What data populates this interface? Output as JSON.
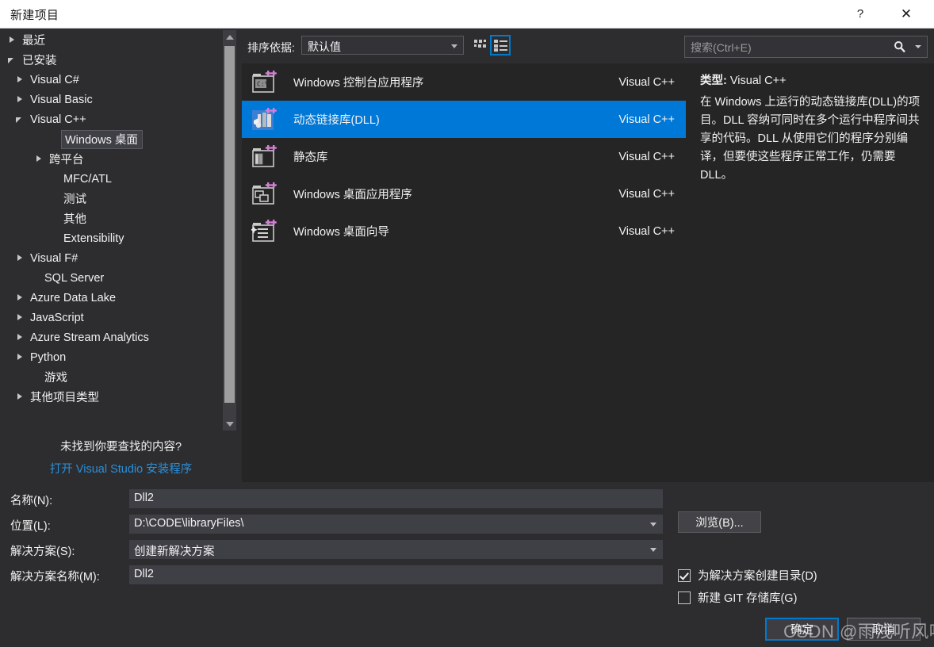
{
  "window": {
    "title": "新建项目",
    "help_label": "?",
    "close_label": "✕"
  },
  "tree": {
    "items": [
      {
        "label": "最近",
        "arrow": "collapsed",
        "indent": 10,
        "selected": false,
        "link": false
      },
      {
        "label": "已安装",
        "arrow": "expanded",
        "indent": 10,
        "selected": false,
        "link": false
      },
      {
        "label": "Visual C#",
        "arrow": "collapsed",
        "indent": 20,
        "selected": false,
        "link": false
      },
      {
        "label": "Visual Basic",
        "arrow": "collapsed",
        "indent": 20,
        "selected": false,
        "link": false
      },
      {
        "label": "Visual C++",
        "arrow": "expanded",
        "indent": 20,
        "selected": false,
        "link": false
      },
      {
        "label": "Windows 桌面",
        "arrow": "none",
        "indent": 62,
        "selected": true,
        "link": false
      },
      {
        "label": "跨平台",
        "arrow": "collapsed",
        "indent": 44,
        "selected": false,
        "link": false
      },
      {
        "label": "MFC/ATL",
        "arrow": "none",
        "indent": 62,
        "selected": false,
        "link": false
      },
      {
        "label": "测试",
        "arrow": "none",
        "indent": 62,
        "selected": false,
        "link": false
      },
      {
        "label": "其他",
        "arrow": "none",
        "indent": 62,
        "selected": false,
        "link": false
      },
      {
        "label": "Extensibility",
        "arrow": "none",
        "indent": 62,
        "selected": false,
        "link": false
      },
      {
        "label": "Visual F#",
        "arrow": "collapsed",
        "indent": 20,
        "selected": false,
        "link": false
      },
      {
        "label": "SQL Server",
        "arrow": "none",
        "indent": 38,
        "selected": false,
        "link": false
      },
      {
        "label": "Azure Data Lake",
        "arrow": "collapsed",
        "indent": 20,
        "selected": false,
        "link": false
      },
      {
        "label": "JavaScript",
        "arrow": "collapsed",
        "indent": 20,
        "selected": false,
        "link": false
      },
      {
        "label": "Azure Stream Analytics",
        "arrow": "collapsed",
        "indent": 20,
        "selected": false,
        "link": false
      },
      {
        "label": "Python",
        "arrow": "collapsed",
        "indent": 20,
        "selected": false,
        "link": false
      },
      {
        "label": "游戏",
        "arrow": "none",
        "indent": 38,
        "selected": false,
        "link": false
      },
      {
        "label": "其他项目类型",
        "arrow": "collapsed",
        "indent": 20,
        "selected": false,
        "link": false
      }
    ],
    "not_found_text": "未找到你要查找的内容?",
    "installer_link": "打开 Visual Studio 安装程序"
  },
  "toolbar": {
    "sort_label": "排序依据:",
    "sort_value": "默认值",
    "grid_view_name": "grid-view-icon",
    "list_view_name": "list-view-icon"
  },
  "search": {
    "placeholder": "搜索(Ctrl+E)",
    "value": "",
    "icon": "search-icon"
  },
  "templates": [
    {
      "name": "Windows 控制台应用程序",
      "language": "Visual C++",
      "icon": "console-app-icon",
      "selected": false
    },
    {
      "name": "动态链接库(DLL)",
      "language": "Visual C++",
      "icon": "dll-icon",
      "selected": true
    },
    {
      "name": "静态库",
      "language": "Visual C++",
      "icon": "static-library-icon",
      "selected": false
    },
    {
      "name": "Windows 桌面应用程序",
      "language": "Visual C++",
      "icon": "desktop-app-icon",
      "selected": false
    },
    {
      "name": "Windows 桌面向导",
      "language": "Visual C++",
      "icon": "desktop-wizard-icon",
      "selected": false
    }
  ],
  "description": {
    "type_key": "类型:",
    "type_value": "Visual C++",
    "body": "在 Windows 上运行的动态链接库(DLL)的项目。DLL 容纳可同时在多个运行中程序间共享的代码。DLL 从使用它们的程序分别编译，但要使这些程序正常工作，仍需要 DLL。"
  },
  "form": {
    "name_label": "名称(N):",
    "name_value": "Dll2",
    "location_label": "位置(L):",
    "location_value": "D:\\CODE\\libraryFiles\\",
    "solution_label": "解决方案(S):",
    "solution_value": "创建新解决方案",
    "solution_name_label": "解决方案名称(M):",
    "solution_name_value": "Dll2",
    "browse_label": "浏览(B)...",
    "create_dir_label": "为解决方案创建目录(D)",
    "create_dir_checked": true,
    "git_repo_label": "新建 GIT 存储库(G)",
    "git_repo_checked": false,
    "ok_label": "确定",
    "cancel_label": "取消"
  },
  "watermark": {
    "text": "CSDN @雨浅听风吟"
  },
  "colors": {
    "accent": "#0078d7",
    "focus_border": "#007acc",
    "dialog_bg": "#2d2d30",
    "panel_bg": "#252526",
    "input_bg": "#3f3f46",
    "link": "#2a8fd8"
  }
}
